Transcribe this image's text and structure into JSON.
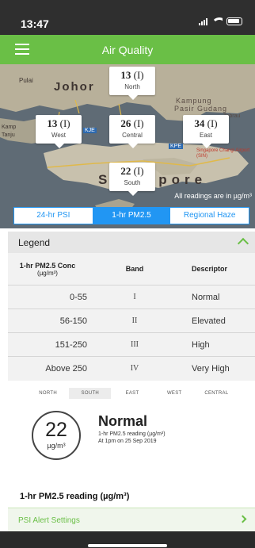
{
  "status_bar": {
    "time": "13:47"
  },
  "app_bar": {
    "title": "Air Quality"
  },
  "map": {
    "labels": {
      "johor": "Johor",
      "singapore": "Singapore",
      "kampung": "Kampung",
      "pasir_gudang": "Pasir Gudang",
      "pulai": "Pulai",
      "kampung_west": "Kamp",
      "tanjung": "Tanju",
      "changi": "Singapore Changi Airport (SIN)",
      "kpe": "KPE",
      "kje": "KJE",
      "sungai_tebrau": "Tebrau"
    },
    "regions": [
      {
        "key": "north",
        "value": "13",
        "band": "(I)",
        "name": "North"
      },
      {
        "key": "west",
        "value": "13",
        "band": "(I)",
        "name": "West"
      },
      {
        "key": "central",
        "value": "26",
        "band": "(I)",
        "name": "Central"
      },
      {
        "key": "east",
        "value": "34",
        "band": "(I)",
        "name": "East"
      },
      {
        "key": "south",
        "value": "22",
        "band": "(I)",
        "name": "South"
      }
    ],
    "note": "All readings are in µg/m³"
  },
  "segments": [
    "24-hr PSI",
    "1-hr PM2.5",
    "Regional Haze"
  ],
  "active_segment": "1-hr PM2.5",
  "legend": {
    "title": "Legend",
    "headers": {
      "conc": "1-hr PM2.5 Conc",
      "conc_unit": "(µg/m³)",
      "band": "Band",
      "descriptor": "Descriptor"
    },
    "rows": [
      {
        "range": "0-55",
        "band": "I",
        "descriptor": "Normal"
      },
      {
        "range": "56-150",
        "band": "II",
        "descriptor": "Elevated"
      },
      {
        "range": "151-250",
        "band": "III",
        "descriptor": "High"
      },
      {
        "range": "Above 250",
        "band": "IV",
        "descriptor": "Very High"
      }
    ]
  },
  "region_tabs": [
    "NORTH",
    "SOUTH",
    "EAST",
    "WEST",
    "CENTRAL"
  ],
  "active_region_tab": "SOUTH",
  "current": {
    "value": "22",
    "unit": "µg/m³",
    "descriptor": "Normal",
    "reading_label": "1-hr PM2.5 reading (µg/m³)",
    "timestamp": "At 1pm on 25 Sep 2019"
  },
  "reading_section_title": "1-hr PM2.5 reading (µg/m³)",
  "psi_alert": {
    "label": "PSI Alert Settings"
  },
  "colors": {
    "accent_green": "#6abf46",
    "segment_blue": "#2196f3",
    "status_bar": "#2f2f2f"
  }
}
